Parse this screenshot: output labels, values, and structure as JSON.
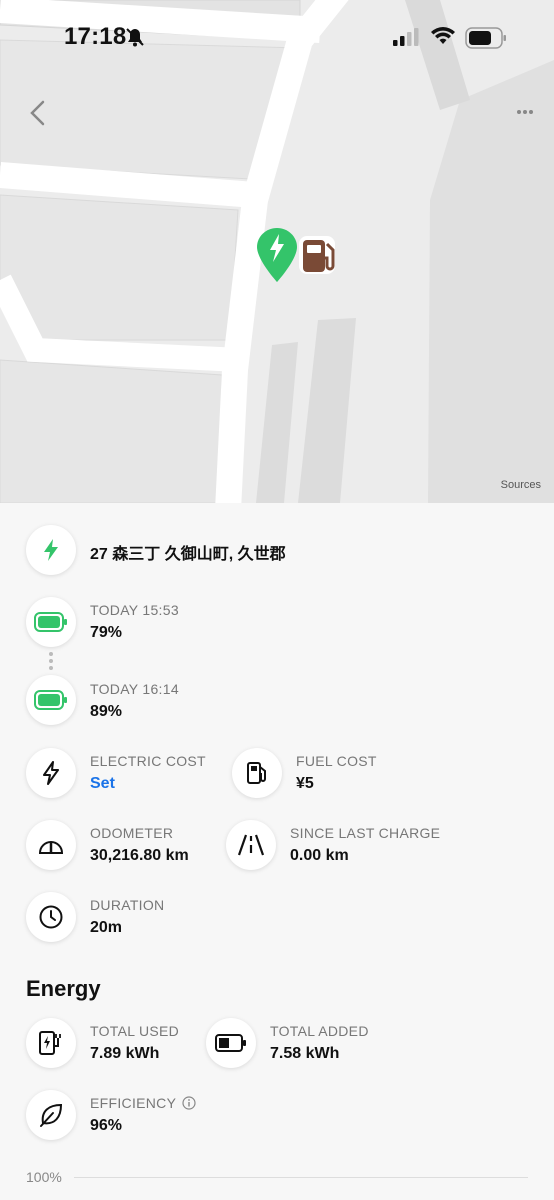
{
  "status_bar": {
    "time": "17:18"
  },
  "map": {
    "sources_label": "Sources"
  },
  "location": {
    "address": "27 森三丁 久御山町, 久世郡"
  },
  "charge": {
    "start_label": "TODAY 15:53",
    "start_value": "79%",
    "end_label": "TODAY 16:14",
    "end_value": "89%"
  },
  "stats": {
    "electric_cost_label": "ELECTRIC COST",
    "electric_cost_value": "Set",
    "fuel_cost_label": "FUEL COST",
    "fuel_cost_value": "¥5",
    "odometer_label": "ODOMETER",
    "odometer_value": "30,216.80 km",
    "since_last_label": "SINCE LAST CHARGE",
    "since_last_value": "0.00 km",
    "duration_label": "DURATION",
    "duration_value": "20m"
  },
  "energy": {
    "title": "Energy",
    "total_used_label": "TOTAL USED",
    "total_used_value": "7.89 kWh",
    "total_added_label": "TOTAL ADDED",
    "total_added_value": "7.58 kWh",
    "efficiency_label": "EFFICIENCY",
    "efficiency_value": "96%",
    "axis_label": "100%"
  },
  "colors": {
    "accent_green": "#34c46a",
    "link_blue": "#1a73e8",
    "fuel_brown": "#7a4a36"
  }
}
